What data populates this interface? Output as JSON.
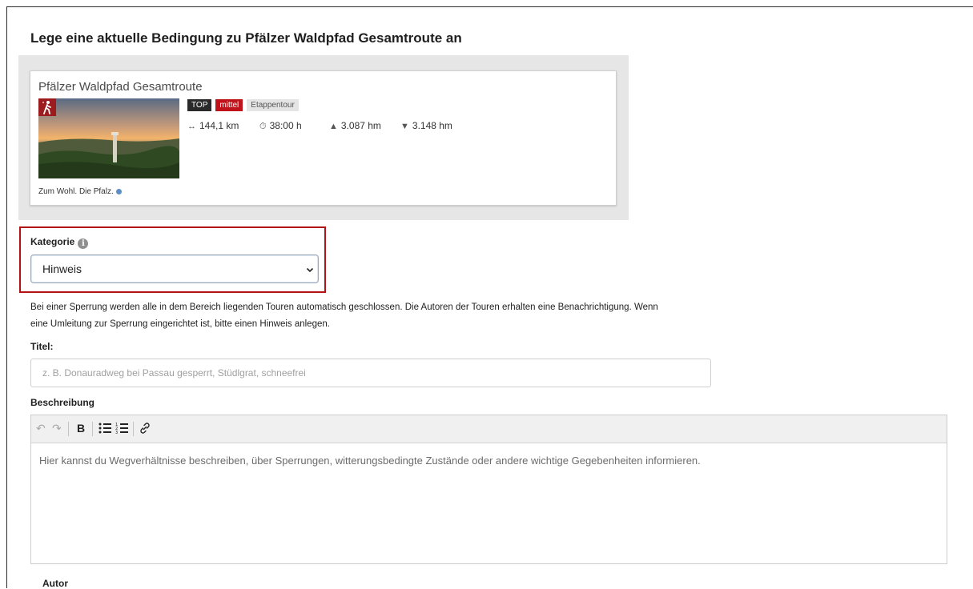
{
  "page": {
    "title": "Lege eine aktuelle Bedingung zu Pfälzer Waldpfad Gesamtroute an"
  },
  "tour": {
    "name": "Pfälzer Waldpfad Gesamtroute",
    "caption": "Zum Wohl. Die Pfalz.",
    "badges": {
      "top": "TOP",
      "level": "mittel",
      "type": "Etappentour"
    },
    "distance": "144,1 km",
    "duration": "38:00 h",
    "ascent": "3.087 hm",
    "descent": "3.148 hm",
    "icons": {
      "distance": "↔",
      "duration": "⏱",
      "ascent": "▲",
      "descent": "▼",
      "activity": "hiker-icon"
    }
  },
  "form": {
    "category_label": "Kategorie",
    "category_value": "Hinweis",
    "help_text": "Bei einer Sperrung werden alle in dem Bereich liegenden Touren automatisch geschlossen. Die Autoren der Touren erhalten eine Benachrichtigung. Wenn eine Umleitung zur Sperrung eingerichtet ist, bitte einen Hinweis anlegen.",
    "title_label": "Titel:",
    "title_placeholder": "z. B. Donauradweg bei Passau gesperrt, Stüdlgrat, schneefrei",
    "description_label": "Beschreibung",
    "description_placeholder": "Hier kannst du Wegverhältnisse beschreiben, über Sperrungen, witterungsbedingte Zustände oder andere wichtige Gegebenheiten informieren.",
    "author_label": "Autor"
  },
  "toolbar": {
    "undo": "↶",
    "redo": "↷",
    "bold": "B",
    "bullet_list": "bullet-list-icon",
    "numbered_list": "numbered-list-icon",
    "link": "link-icon"
  },
  "colors": {
    "accent_red": "#c0121a",
    "highlight": "#b31217",
    "badge_dark": "#2a2a2a"
  }
}
